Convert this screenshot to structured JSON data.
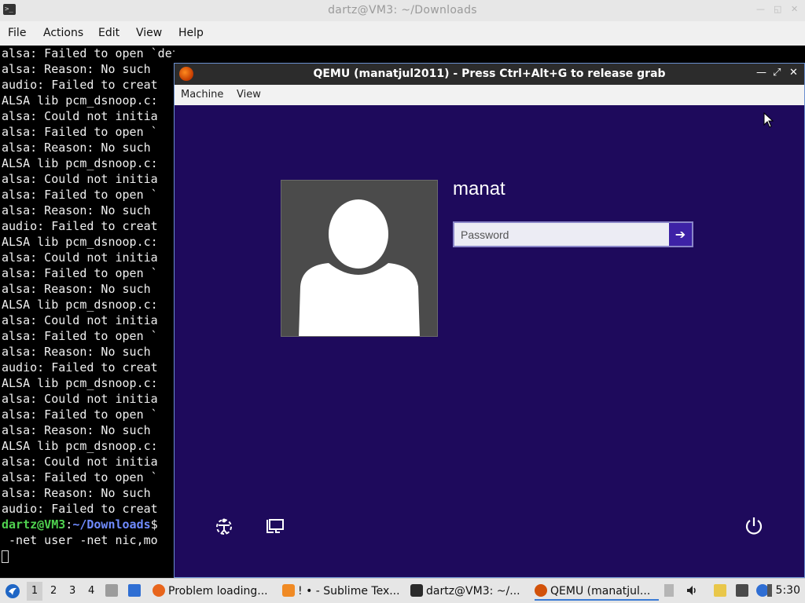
{
  "terminal": {
    "title": "dartz@VM3: ~/Downloads",
    "menu": [
      "File",
      "Actions",
      "Edit",
      "View",
      "Help"
    ],
    "lines": [
      "alsa: Failed to open `default':",
      "alsa: Reason: No such",
      "audio: Failed to creat",
      "ALSA lib pcm_dsnoop.c:",
      "alsa: Could not initia",
      "alsa: Failed to open `",
      "alsa: Reason: No such",
      "ALSA lib pcm_dsnoop.c:",
      "alsa: Could not initia",
      "alsa: Failed to open `",
      "alsa: Reason: No such",
      "audio: Failed to creat",
      "ALSA lib pcm_dsnoop.c:",
      "alsa: Could not initia",
      "alsa: Failed to open `",
      "alsa: Reason: No such",
      "ALSA lib pcm_dsnoop.c:",
      "alsa: Could not initia",
      "alsa: Failed to open `",
      "alsa: Reason: No such",
      "audio: Failed to creat",
      "ALSA lib pcm_dsnoop.c:",
      "alsa: Could not initia",
      "alsa: Failed to open `",
      "alsa: Reason: No such",
      "ALSA lib pcm_dsnoop.c:",
      "alsa: Could not initia",
      "alsa: Failed to open `",
      "alsa: Reason: No such",
      "audio: Failed to creat"
    ],
    "prompt_user": "dartz@VM3",
    "prompt_sep": ":",
    "prompt_path": "~/Downloads",
    "prompt_end": "$",
    "command_cont": " -net user -net nic,mo"
  },
  "qemu": {
    "title": "QEMU (manatjul2011) - Press Ctrl+Alt+G to release grab",
    "menu": [
      "Machine",
      "View"
    ],
    "login": {
      "username": "manat",
      "password_placeholder": "Password",
      "submit_glyph": "➔"
    },
    "icons": [
      "ease-of-access-icon",
      "network-icon",
      "power-icon"
    ]
  },
  "taskbar": {
    "workspaces": [
      "1",
      "2",
      "3",
      "4"
    ],
    "tasks": [
      {
        "label": "Problem loading...",
        "icon": "firefox-icon",
        "color": "#e8651c"
      },
      {
        "label": "! • - Sublime Tex...",
        "icon": "sublime-icon",
        "color": "#f08a24"
      },
      {
        "label": "dartz@VM3: ~/...",
        "icon": "terminal-icon",
        "color": "#2b2b2b"
      },
      {
        "label": "QEMU (manatjul...",
        "icon": "qemu-icon",
        "color": "#d2520a"
      }
    ],
    "clock": "5:30"
  }
}
